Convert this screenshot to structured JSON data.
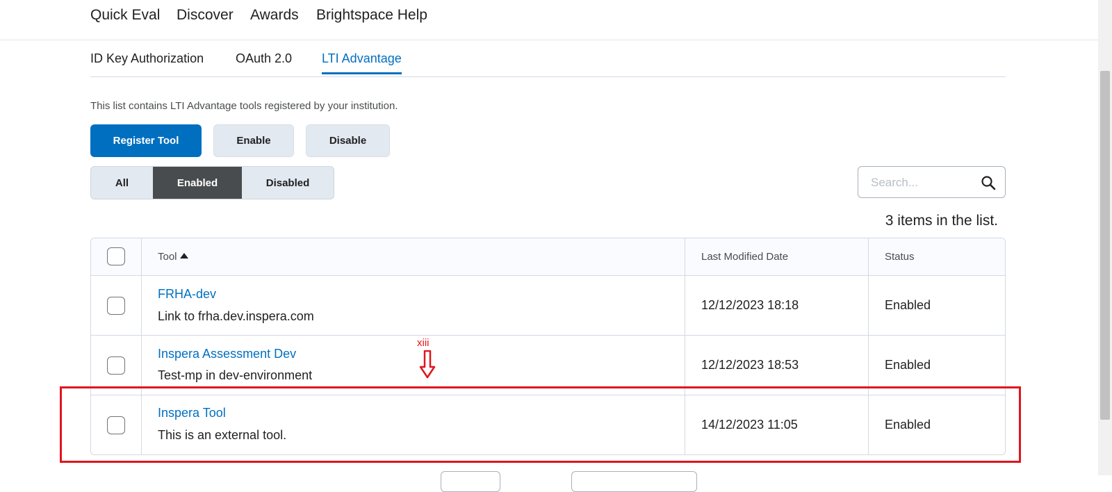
{
  "top_nav": {
    "items": [
      {
        "label": "Quick Eval"
      },
      {
        "label": "Discover"
      },
      {
        "label": "Awards"
      },
      {
        "label": "Brightspace Help"
      }
    ]
  },
  "tabs": [
    {
      "label": "ID Key Authorization",
      "active": false
    },
    {
      "label": "OAuth 2.0",
      "active": false
    },
    {
      "label": "LTI Advantage",
      "active": true
    }
  ],
  "description": "This list contains LTI Advantage tools registered by your institution.",
  "actions": {
    "register": "Register Tool",
    "enable": "Enable",
    "disable": "Disable"
  },
  "filters": {
    "all": "All",
    "enabled": "Enabled",
    "disabled": "Disabled",
    "selected": "Enabled"
  },
  "search": {
    "placeholder": "Search...",
    "value": ""
  },
  "item_count": "3 items in the list.",
  "table": {
    "headers": {
      "tool": "Tool",
      "date": "Last Modified Date",
      "status": "Status"
    },
    "rows": [
      {
        "name": "FRHA-dev",
        "description": "Link to frha.dev.inspera.com",
        "date": "12/12/2023 18:18",
        "status": "Enabled"
      },
      {
        "name": "Inspera Assessment Dev",
        "description": "Test-mp in dev-environment",
        "date": "12/12/2023 18:53",
        "status": "Enabled"
      },
      {
        "name": "Inspera Tool",
        "description": "This is an external tool.",
        "date": "14/12/2023 11:05",
        "status": "Enabled"
      }
    ]
  },
  "annotation": {
    "label": "xiii",
    "color": "#e0151d"
  },
  "colors": {
    "accent": "#006fbf",
    "active_filter": "#494c4e",
    "highlight": "#e0151d"
  }
}
